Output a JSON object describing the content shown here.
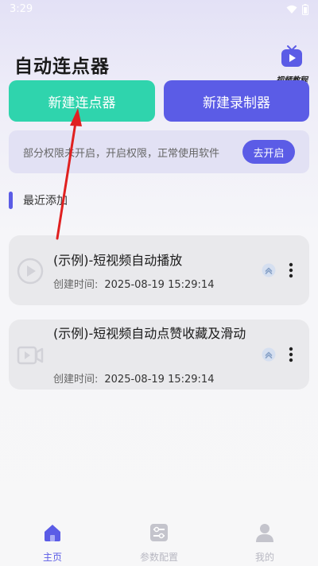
{
  "status_bar": {
    "time": "3:29"
  },
  "header": {
    "title": "自动连点器",
    "tutorial_label": "视频教程"
  },
  "actions": {
    "new_clicker": "新建连点器",
    "new_recorder": "新建录制器"
  },
  "permission_banner": {
    "text": "部分权限未开启，开启权限，正常使用软件",
    "button": "去开启"
  },
  "recent": {
    "title": "最近添加",
    "time_label": "创建时间:",
    "items": [
      {
        "title": "(示例)-短视频自动播放",
        "created": "2025-08-19 15:29:14",
        "icon": "play-circle-icon"
      },
      {
        "title": "(示例)-短视频自动点赞收藏及滑动",
        "created": "2025-08-19 15:29:14",
        "icon": "video-camera-icon"
      }
    ]
  },
  "bottom_nav": {
    "items": [
      {
        "label": "主页",
        "icon": "home-icon",
        "active": true
      },
      {
        "label": "参数配置",
        "icon": "sliders-icon",
        "active": false
      },
      {
        "label": "我的",
        "icon": "user-icon",
        "active": false
      }
    ]
  },
  "colors": {
    "accent_green": "#2fd4ad",
    "accent_purple": "#5b5ce6",
    "annotation_red": "#e02020",
    "nav_active": "#5b5ce6",
    "nav_inactive": "#b8b8c2"
  }
}
